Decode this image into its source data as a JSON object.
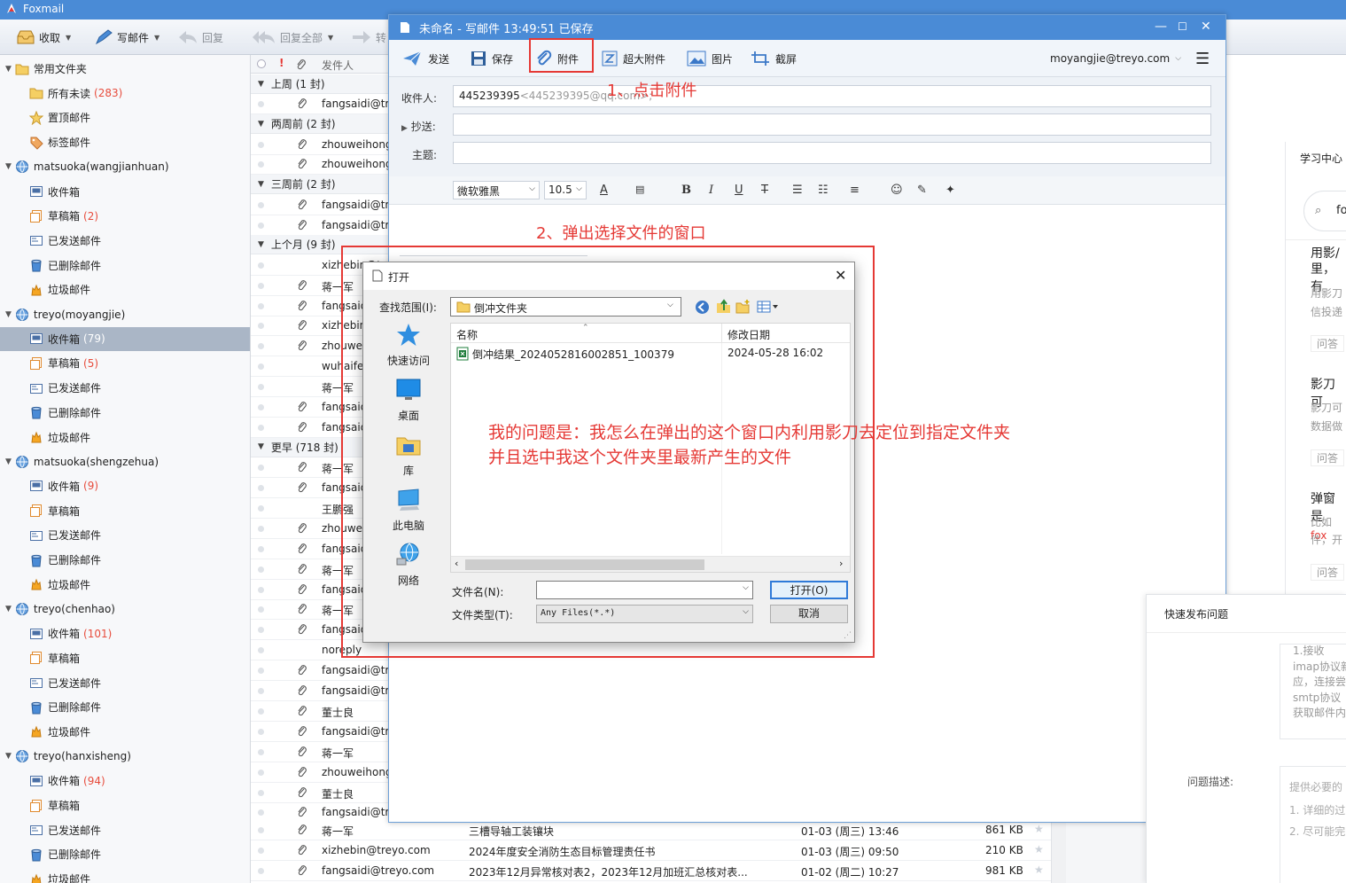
{
  "app": {
    "title": "Foxmail"
  },
  "toolbar": {
    "receive": "收取",
    "compose": "写邮件",
    "reply": "回复",
    "reply_all": "回复全部",
    "forward": "转"
  },
  "sidebar": {
    "common_folder": "常用文件夹",
    "all_unread": "所有未读",
    "all_unread_count": "(283)",
    "pinned": "置顶邮件",
    "tagged": "标签邮件",
    "accounts": [
      {
        "name": "matsuoka(wangjianhuan)",
        "inbox": "收件箱",
        "inbox_count": "",
        "drafts": "草稿箱",
        "drafts_count": "(2)",
        "sent": "已发送邮件",
        "deleted": "已删除邮件",
        "junk": "垃圾邮件"
      },
      {
        "name": "treyo(moyangjie)",
        "inbox": "收件箱",
        "inbox_count": "(79)",
        "drafts": "草稿箱",
        "drafts_count": "(5)",
        "sent": "已发送邮件",
        "deleted": "已删除邮件",
        "junk": "垃圾邮件"
      },
      {
        "name": "matsuoka(shengzehua)",
        "inbox": "收件箱",
        "inbox_count": "(9)",
        "drafts": "草稿箱",
        "drafts_count": "",
        "sent": "已发送邮件",
        "deleted": "已删除邮件",
        "junk": "垃圾邮件"
      },
      {
        "name": "treyo(chenhao)",
        "inbox": "收件箱",
        "inbox_count": "(101)",
        "drafts": "草稿箱",
        "drafts_count": "",
        "sent": "已发送邮件",
        "deleted": "已删除邮件",
        "junk": "垃圾邮件"
      },
      {
        "name": "treyo(hanxisheng)",
        "inbox": "收件箱",
        "inbox_count": "(94)",
        "drafts": "草稿箱",
        "drafts_count": "",
        "sent": "已发送邮件",
        "deleted": "已删除邮件",
        "junk": "垃圾邮件"
      }
    ]
  },
  "maillist": {
    "col_sender": "发件人",
    "groups": [
      "上周 (1 封)",
      "两周前 (2 封)",
      "三周前 (2 封)",
      "上个月 (9 封)",
      "更早 (718 封)"
    ],
    "senders": [
      "fangsaidi@tr",
      "zhouweihong",
      "zhouweihong",
      "fangsaidi@tr",
      "fangsaidi@tr",
      "xizhebin@tre",
      "蒋一军",
      "fangsaid",
      "xizhebin",
      "zhouwei",
      "wuhaife",
      "蒋一军",
      "fangsaid",
      "fangsaid",
      "蒋一军",
      "fangsaid",
      "王鹏强",
      "zhouwei",
      "fangsaid",
      "蒋一军",
      "fangsaid",
      "蒋一军",
      "fangsaid",
      "noreply",
      "fangsaidi@tr",
      "fangsaidi@tr",
      "董士良",
      "fangsaidi@tr",
      "蒋一军",
      "zhouweihong",
      "董士良",
      "fangsaidi@tr"
    ],
    "bottom": [
      {
        "from": "蒋一军",
        "subject": "三槽导轴工装镶块",
        "date": "01-03 (周三) 13:46",
        "size": "861 KB"
      },
      {
        "from": "xizhebin@treyo.com",
        "subject": "2024年度安全消防生态目标管理责任书",
        "date": "01-03 (周三) 09:50",
        "size": "210 KB"
      },
      {
        "from": "fangsaidi@treyo.com",
        "subject": "2023年12月异常核对表2，2023年12月加班汇总核对表...",
        "date": "01-02 (周二) 10:27",
        "size": "981 KB"
      }
    ]
  },
  "compose": {
    "title": "未命名 - 写邮件   13:49:51 已保存",
    "send": "发送",
    "save": "保存",
    "attach": "附件",
    "big_attach": "超大附件",
    "picture": "图片",
    "screenshot": "截屏",
    "account": "moyangjie@treyo.com",
    "to_label": "收件人:",
    "to_name": "445239395",
    "to_addr": "<445239395@qq.com>;",
    "cc_label": "抄送:",
    "subject_label": "主题:",
    "font": "微软雅黑",
    "size": "10.5"
  },
  "dialog": {
    "title": "打开",
    "lookin_label": "查找范围(I):",
    "lookin_value": "倒冲文件夹",
    "places": [
      "快速访问",
      "桌面",
      "库",
      "此电脑",
      "网络"
    ],
    "col_name": "名称",
    "col_date": "修改日期",
    "files": [
      {
        "name": "倒冲结果_20240528160028​51_100379",
        "date": "2024-05-28 16:02"
      }
    ],
    "filename_label": "文件名(N):",
    "filetype_label": "文件类型(T):",
    "filetype_value": "Any Files(*.*)",
    "open_btn": "打开(O)",
    "cancel_btn": "取消"
  },
  "annotations": {
    "step1": "1、点击附件",
    "step2": "2、弹出选择文件的窗口",
    "question_line1": "我的问题是：我怎么在弹出的这个窗口内利用影刀去定位到指定文件夹",
    "question_line2": "并且选中我这个文件夹里最新产生的文件"
  },
  "right_panel": {
    "learn": "学习中心",
    "search": "fo",
    "t1": "用影/",
    "t1b": "里，有",
    "s1a": "用影刀",
    "s1b": "信投递",
    "tag1": "问答",
    "t2": "影刀可",
    "s2a": "影刀可",
    "s2b": "数据做",
    "tag2": "问答",
    "t3": "弹窗是",
    "s3a": "比如",
    "s3a_red": "fox",
    "s3b": "件，开",
    "tag3": "问答"
  },
  "quick_panel": {
    "title": "快速发布问题",
    "lines": [
      "1.接收",
      "imap协议新",
      "应，连接尝",
      "smtp协议",
      "获取邮件内"
    ],
    "desc_label": "问题描述:",
    "hint1": "提供必要的",
    "hint2": "1. 详细的过",
    "hint3": "2. 尽可能完"
  },
  "colors": {
    "accent": "#4a8bd6",
    "annotation": "#e53935",
    "count": "#e74c3c"
  }
}
